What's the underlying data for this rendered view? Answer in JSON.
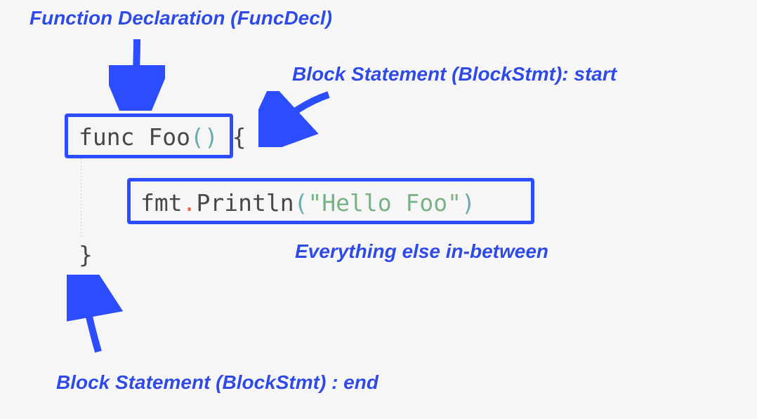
{
  "annotations": {
    "funcdecl": "Function Declaration (FuncDecl)",
    "blockstart": "Block Statement (BlockStmt): start",
    "inbetween": "Everything else in-between",
    "blockend": "Block Statement (BlockStmt) : end"
  },
  "code": {
    "line1_func": "func",
    "line1_name": " Foo",
    "line1_parens": "()",
    "line1_brace_open": " {",
    "line2_pkg": "fmt",
    "line2_dot": ".",
    "line2_fn": "Println",
    "line2_paren_open": "(",
    "line2_string": "\"Hello Foo\"",
    "line2_paren_close": ")",
    "line3_brace_close": "}"
  }
}
